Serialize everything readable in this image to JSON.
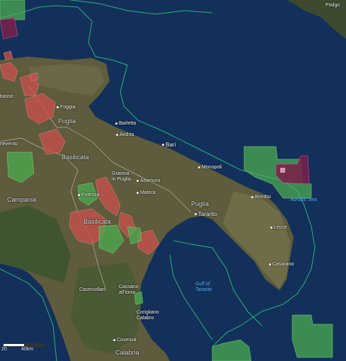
{
  "map": {
    "labels": {
      "podgorica": "Podgo",
      "foggia": "Foggia",
      "puglia_north": "Puglia",
      "barletta": "Barletta",
      "andria": "Andria",
      "bari": "Bari",
      "monopoli": "Monopoli",
      "basilicata_north": "Basilicata",
      "gravina": "Gravina\nin Puglia",
      "altamura": "Altamura",
      "matera": "Matera",
      "brindisi": "Brindisi",
      "adriatic": "Adriatic Sea",
      "campania": "Campania",
      "potenza": "Potenza",
      "puglia_south": "Puglia",
      "taranto": "Taranto",
      "basilicata_south": "Basilicata",
      "lecce": "Lecce",
      "casarano": "Casarano",
      "gulf": "Gulf of\nTaranto",
      "castrovillari": "Castrovillari",
      "cassano": "Cassano\nall'Ionio",
      "corigliano": "Corigliano\nCalabro",
      "cosenza": "Cosenza",
      "calabria": "Calabria",
      "nevento": "nevento",
      "basso": "basso"
    },
    "scale": {
      "left": "20",
      "right": "40km"
    },
    "colors": {
      "sea": "#0f2a4e",
      "land": "#5c5a3a",
      "red_block": "#c8504a",
      "green_block": "#4caf50",
      "purple_block": "#7a1f4a",
      "boundary": "#2bb37a"
    }
  }
}
